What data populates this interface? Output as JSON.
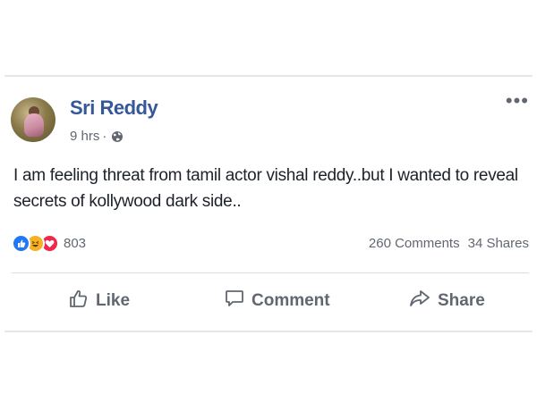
{
  "post": {
    "author": "Sri Reddy",
    "time": "9 hrs",
    "separator": "·",
    "privacy_icon": "globe-icon",
    "more_label": "•••",
    "text": "I am feeling threat from tamil actor vishal reddy..but I wanted to reveal secrets of kollywood dark side..",
    "reactions": {
      "types": [
        "like-icon",
        "haha-icon",
        "love-icon"
      ],
      "count": "803"
    },
    "comments_count": "260 Comments",
    "shares_count": "34 Shares",
    "actions": {
      "like_label": "Like",
      "comment_label": "Comment",
      "share_label": "Share"
    }
  },
  "colors": {
    "author_name": "#365899",
    "secondary_text": "#616770",
    "like_blue": "#2078f4",
    "haha_yellow": "#f7b125",
    "love_red": "#f0284a"
  }
}
